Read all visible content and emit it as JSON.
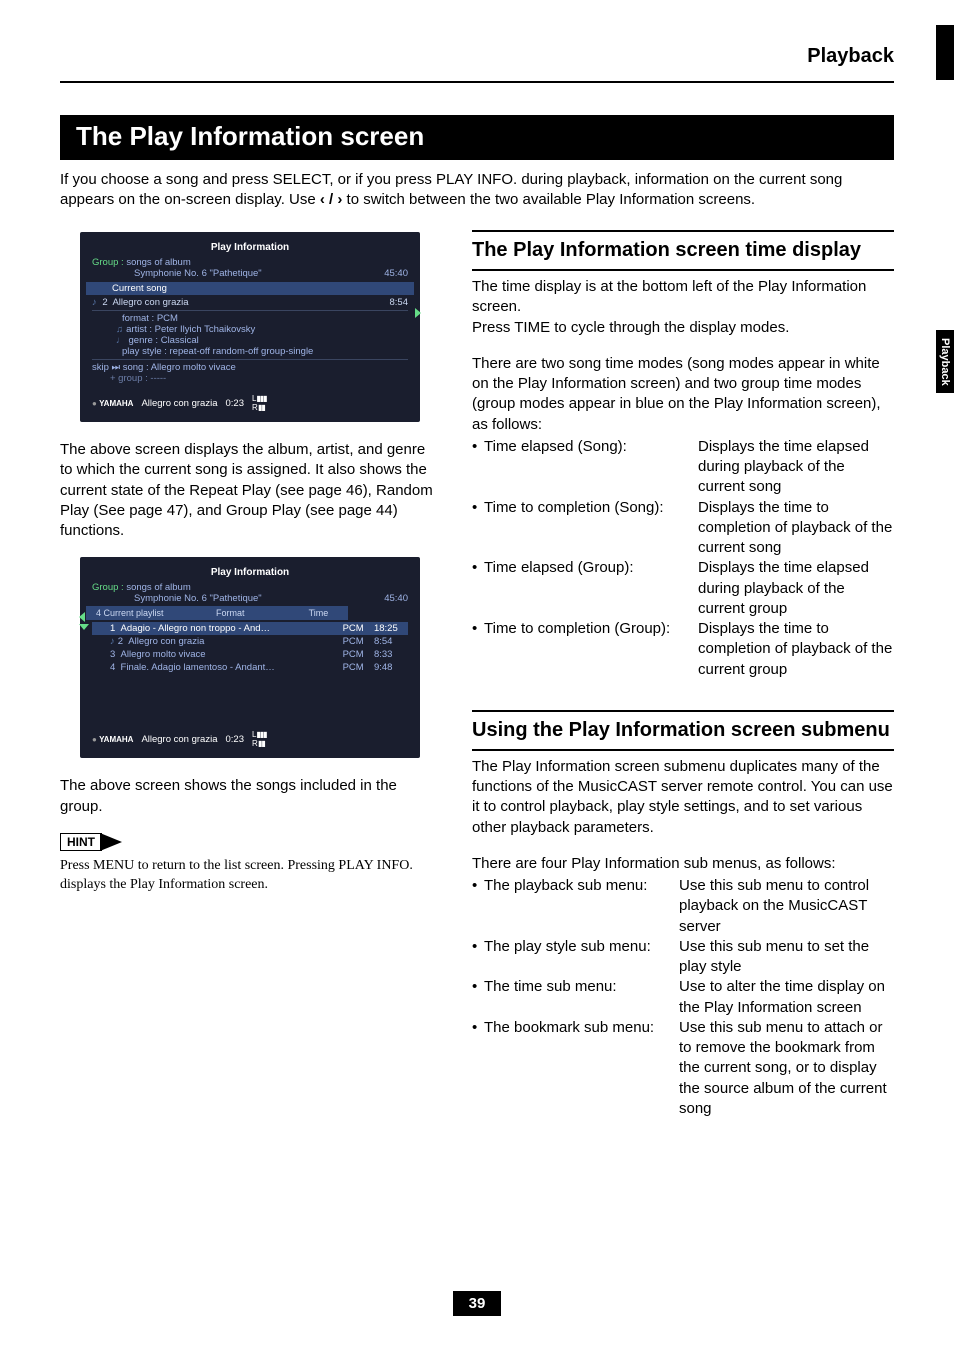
{
  "header": {
    "section": "Playback",
    "page_number": "39"
  },
  "side_tab": "Playback",
  "banner": "The Play Information screen",
  "intro_a": "If you choose a song and press SELECT, or if you press PLAY INFO. during playback, information on the current song appears on the on-screen display. Use ",
  "intro_glyph": "‹ / ›",
  "intro_b": " to switch between the two available Play Information screens.",
  "ss1": {
    "title": "Play Information",
    "group_label": "Group :",
    "group_line1": "songs of album",
    "group_line2": "Symphonie No. 6 \"Pathetique\"",
    "total_time": "45:40",
    "cs_label": "Current song",
    "cs_num": "2",
    "cs_title": "Allegro con grazia",
    "cs_time": "8:54",
    "format": "format : PCM",
    "artist": "artist : Peter Ilyich Tchaikovsky",
    "genre": "genre : Classical",
    "ps": "play style : repeat-off    random-off      group-single",
    "skip": "skip  ⏭  song : Allegro molto vivace",
    "skip2": "       + group : -----",
    "footer_brand": "YAMAHA",
    "footer_title": "Allegro con grazia",
    "footer_time": "0:23"
  },
  "left_p1": "The above screen displays the album, artist, and genre to which the current song is assigned. It also shows the current state of the Repeat Play (see page 46), Random Play (See page 47), and Group Play (see page 44) functions.",
  "ss2": {
    "title": "Play Information",
    "group_label": "Group :",
    "group_line1": "songs of album",
    "group_line2": "Symphonie No. 6 \"Pathetique\"",
    "total_time": "45:40",
    "pl_label": "4  Current playlist",
    "col_format": "Format",
    "col_time": "Time",
    "rows": [
      {
        "n": "1",
        "t": "Adagio - Allegro non troppo - And…",
        "f": "PCM",
        "d": "18:25",
        "hi": true
      },
      {
        "n": "2",
        "t": "Allegro con grazia",
        "f": "PCM",
        "d": "8:54"
      },
      {
        "n": "3",
        "t": "Allegro molto vivace",
        "f": "PCM",
        "d": "8:33"
      },
      {
        "n": "4",
        "t": "Finale. Adagio lamentoso - Andant…",
        "f": "PCM",
        "d": "9:48"
      }
    ],
    "footer_brand": "YAMAHA",
    "footer_title": "Allegro con grazia",
    "footer_time": "0:23"
  },
  "left_p2": "The above screen shows the songs included in the group.",
  "hint_label": "HINT",
  "hint_text": "Press MENU to return to the list screen. Pressing PLAY INFO. displays the Play Information screen.",
  "sec1": {
    "title": "The Play Information screen time display",
    "p1": "The time display is at the bottom left of the Play Information screen.",
    "p2": "Press TIME to cycle through the display modes.",
    "p3": "There are two song time modes (song modes appear in white on the Play Information screen) and two group time modes (group modes appear in blue on the Play Information screen), as follows:",
    "items": [
      {
        "label": "Time elapsed (Song):",
        "val": "Displays the time elapsed during playback of the current song"
      },
      {
        "label": "Time to completion (Song):",
        "val": "Displays the time to completion of playback of the current song"
      },
      {
        "label": "Time elapsed (Group):",
        "val": "Displays the time elapsed during playback of the current group"
      },
      {
        "label": "Time to completion (Group):",
        "val": "Displays the time to completion of playback of the current group"
      }
    ]
  },
  "sec2": {
    "title": "Using the Play Information screen submenu",
    "p1": "The Play Information screen submenu duplicates many of the functions of the MusicCAST server remote control. You can use it to control playback, play style settings, and to set various other playback parameters.",
    "p2": "There are four Play Information sub menus, as follows:",
    "items": [
      {
        "label": "The playback sub menu:",
        "val": "Use this sub menu to control playback on the MusicCAST server"
      },
      {
        "label": "The play style sub menu:",
        "val": "Use this sub menu to set the play style"
      },
      {
        "label": "The time sub menu:",
        "val": "Use to alter the time display on the Play Information screen"
      },
      {
        "label": "The bookmark sub menu:",
        "val": "Use this sub menu to attach or to remove the bookmark from the current song, or to display the source album of the current song"
      }
    ]
  }
}
